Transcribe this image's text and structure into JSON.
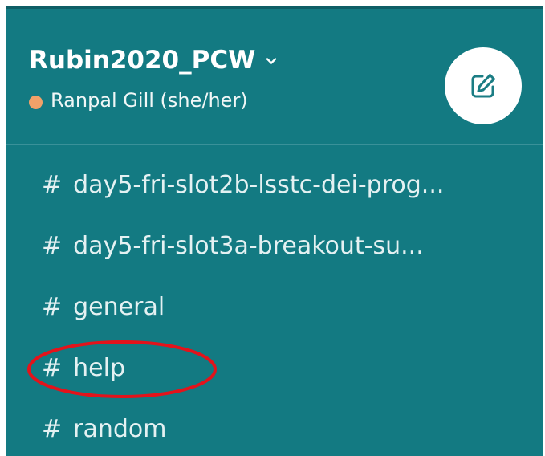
{
  "workspace": {
    "name": "Rubin2020_PCW",
    "user_name": "Ranpal Gill (she/her)",
    "presence_color": "#f1a169"
  },
  "compose": {
    "icon": "compose-icon"
  },
  "channels": [
    {
      "hash": "#",
      "name": "day5-fri-slot2b-lsstc-dei-prog..."
    },
    {
      "hash": "#",
      "name": "day5-fri-slot3a-breakout-su..."
    },
    {
      "hash": "#",
      "name": "general"
    },
    {
      "hash": "#",
      "name": "help"
    },
    {
      "hash": "#",
      "name": "random"
    }
  ],
  "highlight": {
    "target": "help",
    "color": "#e3131b"
  },
  "colors": {
    "sidebar": "#137a82",
    "text": "#ffffff",
    "compose_bg": "#ffffff",
    "compose_icon": "#1b7d84"
  }
}
